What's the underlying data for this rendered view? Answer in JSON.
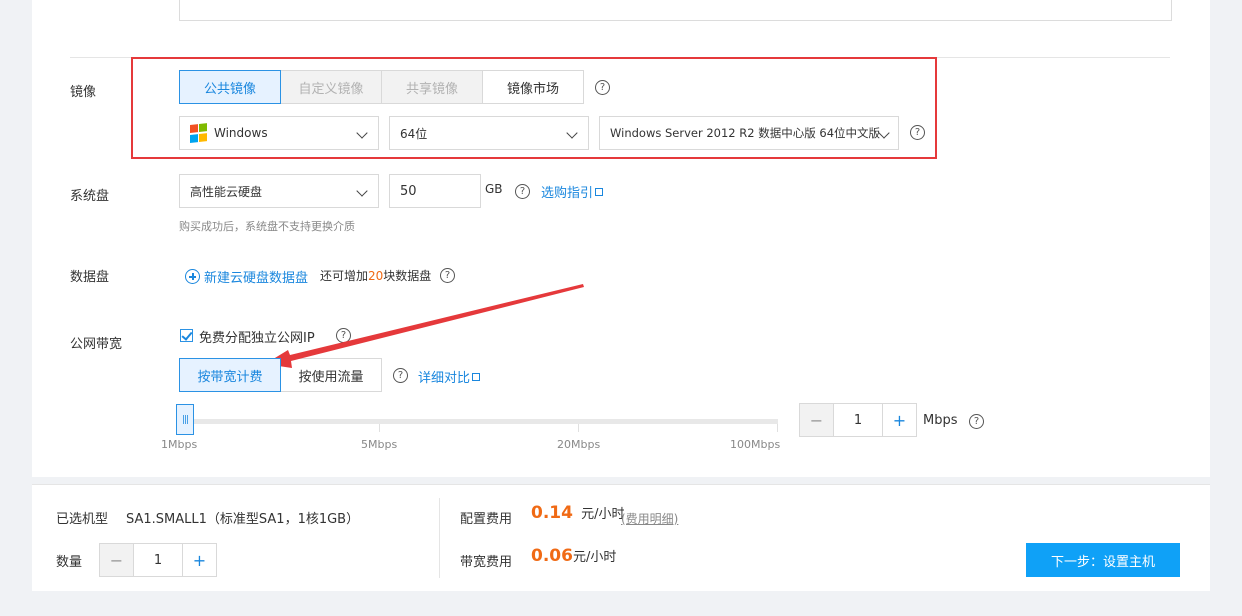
{
  "image": {
    "label": "镜像",
    "tabs": [
      "公共镜像",
      "自定义镜像",
      "共享镜像",
      "镜像市场"
    ],
    "os_type": "Windows",
    "bits": "64位",
    "version": "Windows Server 2012 R2 数据中心版 64位中文版"
  },
  "system_disk": {
    "label": "系统盘",
    "type": "高性能云硬盘",
    "size": "50",
    "unit": "GB",
    "guide_link": "选购指引",
    "hint": "购买成功后，系统盘不支持更换介质"
  },
  "data_disk": {
    "label": "数据盘",
    "add_link": "新建云硬盘数据盘",
    "remaining_prefix": "还可增加",
    "remaining_count": "20",
    "remaining_suffix": "块数据盘"
  },
  "bandwidth": {
    "label": "公网带宽",
    "free_ip_label": "免费分配独立公网IP",
    "billing_tabs": [
      "按带宽计费",
      "按使用流量"
    ],
    "compare_link": "详细对比",
    "ticks": [
      "1Mbps",
      "5Mbps",
      "20Mbps",
      "100Mbps"
    ],
    "value": "1",
    "unit": "Mbps",
    "slider_level_mbps": 1
  },
  "footer": {
    "model_label": "已选机型",
    "model_value": "SA1.SMALL1（标准型SA1，1核1GB）",
    "qty_label": "数量",
    "qty_value": "1",
    "config_fee_label": "配置费用",
    "config_fee_value": "0.14",
    "config_fee_unit": "元/小时",
    "fee_detail_link": "(费用明细)",
    "bw_fee_label": "带宽费用",
    "bw_fee_value": "0.06",
    "bw_fee_unit": "元/小时",
    "next_button": "下一步：设置主机"
  },
  "icons": {
    "help": "question-circle-icon",
    "external": "external-link-icon",
    "add": "plus-circle-icon",
    "os": "windows-logo-icon"
  },
  "colors": {
    "accent": "#1a87de",
    "price": "#f06a15",
    "primary_button": "#0fa1f7",
    "annotation": "#e5393b"
  }
}
